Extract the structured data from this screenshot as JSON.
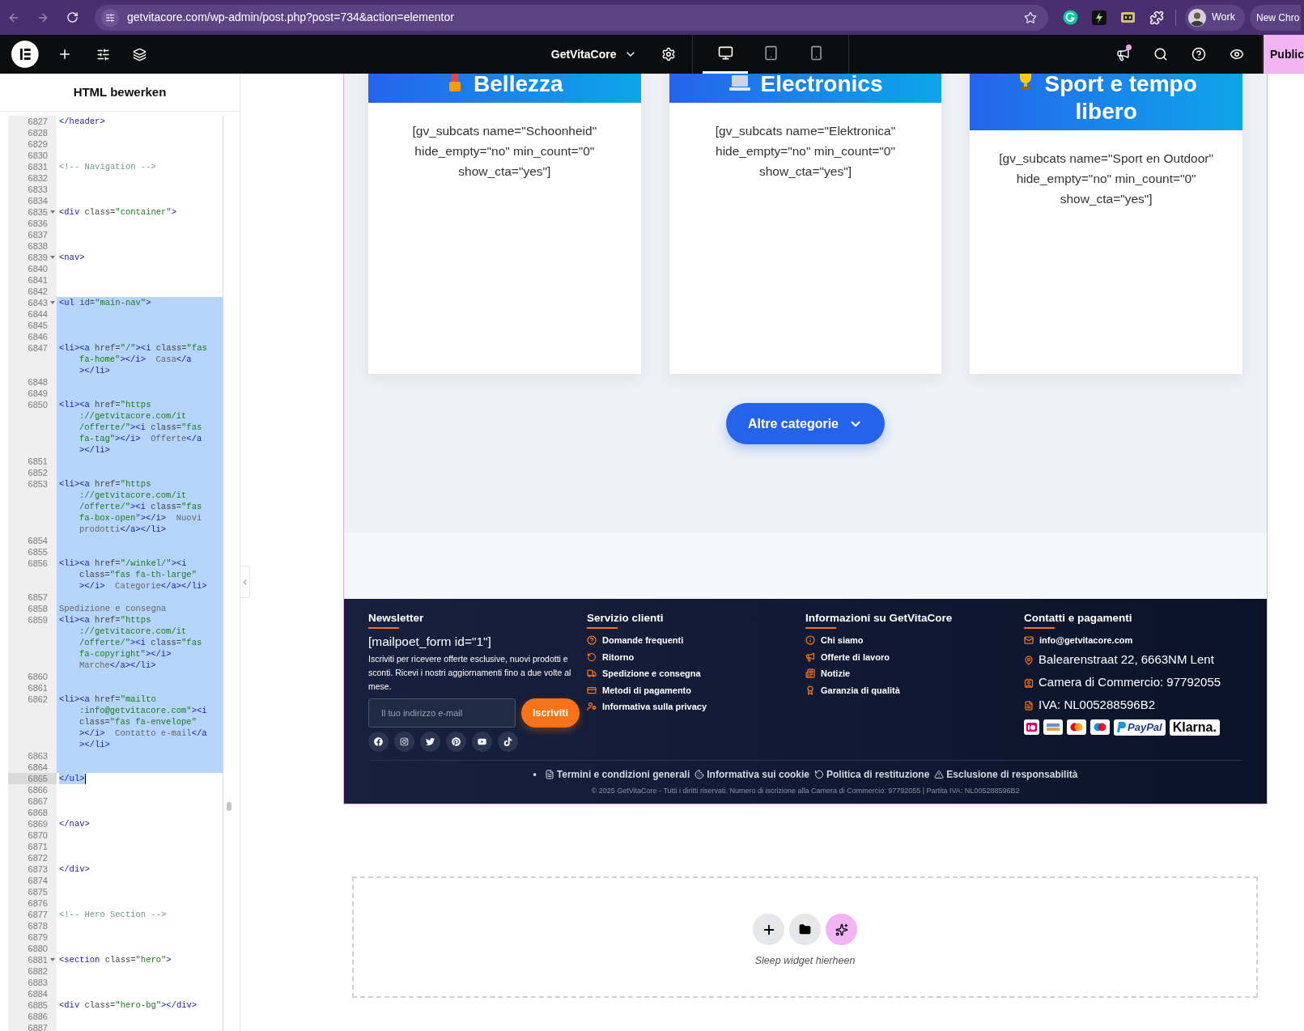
{
  "browser": {
    "url": "getvitacore.com/wp-admin/post.php?post=734&action=elementor",
    "profile": "Work",
    "new_window": "New Chro"
  },
  "editor_bar": {
    "site_name": "GetVitaCore",
    "devices": [
      {
        "kind": "desktop",
        "selected": true
      },
      {
        "kind": "tablet",
        "selected": false
      },
      {
        "kind": "mobile",
        "selected": false
      }
    ],
    "has_notification": true,
    "publish": "Public"
  },
  "html_panel": {
    "title": "HTML bewerken",
    "lines": [
      {
        "number": "6827",
        "selected": false,
        "active": false,
        "foldable": false,
        "rows": [
          {
            "tokens": [
              {
                "kind": "tag",
                "text": "</header>"
              }
            ]
          }
        ]
      },
      {
        "number": "6828",
        "selected": false,
        "active": false,
        "foldable": false
      },
      {
        "number": "6829",
        "selected": false,
        "active": false,
        "foldable": false
      },
      {
        "number": "6830",
        "selected": false,
        "active": false,
        "foldable": false
      },
      {
        "number": "6831",
        "selected": false,
        "active": false,
        "foldable": false,
        "rows": [
          {
            "tokens": [
              {
                "kind": "comment",
                "text": "<!-- Navigation -->"
              }
            ]
          }
        ]
      },
      {
        "number": "6832",
        "selected": false,
        "active": false,
        "foldable": false
      },
      {
        "number": "6833",
        "selected": false,
        "active": false,
        "foldable": false
      },
      {
        "number": "6834",
        "selected": false,
        "active": false,
        "foldable": false
      },
      {
        "number": "6835",
        "selected": false,
        "active": false,
        "foldable": true,
        "rows": [
          {
            "tokens": [
              {
                "kind": "tag",
                "text": "<div"
              },
              {
                "kind": "attr",
                "text": " class="
              },
              {
                "kind": "str",
                "text": "\"container\""
              },
              {
                "kind": "tag",
                "text": ">"
              }
            ]
          }
        ]
      },
      {
        "number": "6836",
        "selected": false,
        "active": false,
        "foldable": false
      },
      {
        "number": "6837",
        "selected": false,
        "active": false,
        "foldable": false
      },
      {
        "number": "6838",
        "selected": false,
        "active": false,
        "foldable": false
      },
      {
        "number": "6839",
        "selected": false,
        "active": false,
        "foldable": true,
        "rows": [
          {
            "tokens": [
              {
                "kind": "tag",
                "text": "<nav>"
              }
            ]
          }
        ]
      },
      {
        "number": "6840",
        "selected": false,
        "active": false,
        "foldable": false
      },
      {
        "number": "6841",
        "selected": false,
        "active": false,
        "foldable": false
      },
      {
        "number": "6842",
        "selected": false,
        "active": false,
        "foldable": false
      },
      {
        "number": "6843",
        "selected": true,
        "active": false,
        "foldable": true,
        "rows": [
          {
            "tokens": [
              {
                "kind": "tag",
                "text": "<ul"
              },
              {
                "kind": "attr",
                "text": " id="
              },
              {
                "kind": "str",
                "text": "\"main-nav\""
              },
              {
                "kind": "tag",
                "text": ">"
              }
            ]
          }
        ]
      },
      {
        "number": "6844",
        "selected": true,
        "active": false,
        "foldable": false
      },
      {
        "number": "6845",
        "selected": true,
        "active": false,
        "foldable": false
      },
      {
        "number": "6846",
        "selected": true,
        "active": false,
        "foldable": false
      },
      {
        "number": "6847",
        "selected": true,
        "active": false,
        "foldable": false,
        "rows": [
          {
            "tokens": [
              {
                "kind": "tag",
                "text": "<li><a"
              },
              {
                "kind": "attr",
                "text": " href="
              },
              {
                "kind": "str",
                "text": "\"/\""
              },
              {
                "kind": "tag",
                "text": "><i"
              },
              {
                "kind": "attr",
                "text": " class="
              },
              {
                "kind": "str",
                "text": "\"fas"
              }
            ]
          },
          {
            "tokens": [
              {
                "kind": "str",
                "text": "fa-home\""
              },
              {
                "kind": "tag",
                "text": "></i>"
              },
              {
                "kind": "text",
                "text": "  Casa"
              },
              {
                "kind": "tag",
                "text": "</a"
              }
            ]
          },
          {
            "tokens": [
              {
                "kind": "tag",
                "text": "></li>"
              }
            ]
          }
        ]
      },
      {
        "number": "6848",
        "selected": true,
        "active": false,
        "foldable": false
      },
      {
        "number": "6849",
        "selected": true,
        "active": false,
        "foldable": false
      },
      {
        "number": "6850",
        "selected": true,
        "active": false,
        "foldable": false,
        "rows": [
          {
            "tokens": [
              {
                "kind": "tag",
                "text": "<li><a"
              },
              {
                "kind": "attr",
                "text": " href="
              },
              {
                "kind": "str",
                "text": "\"https"
              }
            ]
          },
          {
            "tokens": [
              {
                "kind": "str",
                "text": "://getvitacore.com/it"
              }
            ]
          },
          {
            "tokens": [
              {
                "kind": "str",
                "text": "/offerte/\""
              },
              {
                "kind": "tag",
                "text": "><i"
              },
              {
                "kind": "attr",
                "text": " class="
              },
              {
                "kind": "str",
                "text": "\"fas"
              }
            ]
          },
          {
            "tokens": [
              {
                "kind": "str",
                "text": "fa-tag\""
              },
              {
                "kind": "tag",
                "text": "></i>"
              },
              {
                "kind": "text",
                "text": "  Offerte"
              },
              {
                "kind": "tag",
                "text": "</a"
              }
            ]
          },
          {
            "tokens": [
              {
                "kind": "tag",
                "text": "></li>"
              }
            ]
          }
        ]
      },
      {
        "number": "6851",
        "selected": true,
        "active": false,
        "foldable": false
      },
      {
        "number": "6852",
        "selected": true,
        "active": false,
        "foldable": false
      },
      {
        "number": "6853",
        "selected": true,
        "active": false,
        "foldable": false,
        "rows": [
          {
            "tokens": [
              {
                "kind": "tag",
                "text": "<li><a"
              },
              {
                "kind": "attr",
                "text": " href="
              },
              {
                "kind": "str",
                "text": "\"https"
              }
            ]
          },
          {
            "tokens": [
              {
                "kind": "str",
                "text": "://getvitacore.com/it"
              }
            ]
          },
          {
            "tokens": [
              {
                "kind": "str",
                "text": "/offerte/\""
              },
              {
                "kind": "tag",
                "text": "><i"
              },
              {
                "kind": "attr",
                "text": " class="
              },
              {
                "kind": "str",
                "text": "\"fas"
              }
            ]
          },
          {
            "tokens": [
              {
                "kind": "str",
                "text": "fa-box-open\""
              },
              {
                "kind": "tag",
                "text": "></i>"
              },
              {
                "kind": "text",
                "text": "  Nuovi"
              }
            ]
          },
          {
            "tokens": [
              {
                "kind": "text",
                "text": "prodotti"
              },
              {
                "kind": "tag",
                "text": "</a></li>"
              }
            ]
          }
        ]
      },
      {
        "number": "6854",
        "selected": true,
        "active": false,
        "foldable": false
      },
      {
        "number": "6855",
        "selected": true,
        "active": false,
        "foldable": false
      },
      {
        "number": "6856",
        "selected": true,
        "active": false,
        "foldable": false,
        "rows": [
          {
            "tokens": [
              {
                "kind": "tag",
                "text": "<li><a"
              },
              {
                "kind": "attr",
                "text": " href="
              },
              {
                "kind": "str",
                "text": "\"/winkel/\""
              },
              {
                "kind": "tag",
                "text": "><i"
              }
            ]
          },
          {
            "tokens": [
              {
                "kind": "attr",
                "text": "class="
              },
              {
                "kind": "str",
                "text": "\"fas fa-th-large\""
              }
            ]
          },
          {
            "tokens": [
              {
                "kind": "tag",
                "text": "></i>"
              },
              {
                "kind": "text",
                "text": "  Categorie"
              },
              {
                "kind": "tag",
                "text": "</a></li>"
              }
            ]
          }
        ]
      },
      {
        "number": "6857",
        "selected": true,
        "active": false,
        "foldable": false
      },
      {
        "number": "6858",
        "selected": true,
        "active": false,
        "foldable": false,
        "rows": [
          {
            "tokens": [
              {
                "kind": "text",
                "text": "Spedizione e consegna"
              }
            ]
          }
        ]
      },
      {
        "number": "6859",
        "selected": true,
        "active": false,
        "foldable": false,
        "rows": [
          {
            "tokens": [
              {
                "kind": "tag",
                "text": "<li><a"
              },
              {
                "kind": "attr",
                "text": " href="
              },
              {
                "kind": "str",
                "text": "\"https"
              }
            ]
          },
          {
            "tokens": [
              {
                "kind": "str",
                "text": "://getvitacore.com/it"
              }
            ]
          },
          {
            "tokens": [
              {
                "kind": "str",
                "text": "/offerte/\""
              },
              {
                "kind": "tag",
                "text": "><i"
              },
              {
                "kind": "attr",
                "text": " class="
              },
              {
                "kind": "str",
                "text": "\"fas"
              }
            ]
          },
          {
            "tokens": [
              {
                "kind": "str",
                "text": "fa-copyright\""
              },
              {
                "kind": "tag",
                "text": "></i>"
              }
            ]
          },
          {
            "tokens": [
              {
                "kind": "text",
                "text": "Marche"
              },
              {
                "kind": "tag",
                "text": "</a></li>"
              }
            ]
          }
        ]
      },
      {
        "number": "6860",
        "selected": true,
        "active": false,
        "foldable": false
      },
      {
        "number": "6861",
        "selected": true,
        "active": false,
        "foldable": false
      },
      {
        "number": "6862",
        "selected": true,
        "active": false,
        "foldable": false,
        "rows": [
          {
            "tokens": [
              {
                "kind": "tag",
                "text": "<li><a"
              },
              {
                "kind": "attr",
                "text": " href="
              },
              {
                "kind": "str",
                "text": "\"mailto"
              }
            ]
          },
          {
            "tokens": [
              {
                "kind": "str",
                "text": ":info@getvitacore.com\""
              },
              {
                "kind": "tag",
                "text": "><i"
              }
            ]
          },
          {
            "tokens": [
              {
                "kind": "attr",
                "text": "class="
              },
              {
                "kind": "str",
                "text": "\"fas fa-envelope\""
              }
            ]
          },
          {
            "tokens": [
              {
                "kind": "tag",
                "text": "></i>"
              },
              {
                "kind": "text",
                "text": "  Contatto e-mail"
              },
              {
                "kind": "tag",
                "text": "</a"
              }
            ]
          },
          {
            "tokens": [
              {
                "kind": "tag",
                "text": "></li>"
              }
            ]
          }
        ]
      },
      {
        "number": "6863",
        "selected": true,
        "active": false,
        "foldable": false
      },
      {
        "number": "6864",
        "selected": true,
        "active": false,
        "foldable": false
      },
      {
        "number": "6865",
        "selected": false,
        "active": true,
        "foldable": false,
        "rows": [
          {
            "tokens": [
              {
                "kind": "tag",
                "text": "</ul>"
              }
            ]
          }
        ]
      },
      {
        "number": "6866",
        "selected": false,
        "active": false,
        "foldable": false
      },
      {
        "number": "6867",
        "selected": false,
        "active": false,
        "foldable": false
      },
      {
        "number": "6868",
        "selected": false,
        "active": false,
        "foldable": false
      },
      {
        "number": "6869",
        "selected": false,
        "active": false,
        "foldable": false,
        "rows": [
          {
            "tokens": [
              {
                "kind": "tag",
                "text": "</nav>"
              }
            ]
          }
        ]
      },
      {
        "number": "6870",
        "selected": false,
        "active": false,
        "foldable": false
      },
      {
        "number": "6871",
        "selected": false,
        "active": false,
        "foldable": false
      },
      {
        "number": "6872",
        "selected": false,
        "active": false,
        "foldable": false
      },
      {
        "number": "6873",
        "selected": false,
        "active": false,
        "foldable": false,
        "rows": [
          {
            "tokens": [
              {
                "kind": "tag",
                "text": "</div>"
              }
            ]
          }
        ]
      },
      {
        "number": "6874",
        "selected": false,
        "active": false,
        "foldable": false
      },
      {
        "number": "6875",
        "selected": false,
        "active": false,
        "foldable": false
      },
      {
        "number": "6876",
        "selected": false,
        "active": false,
        "foldable": false
      },
      {
        "number": "6877",
        "selected": false,
        "active": false,
        "foldable": false,
        "rows": [
          {
            "tokens": [
              {
                "kind": "comment",
                "text": "<!-- Hero Section -->"
              }
            ]
          }
        ]
      },
      {
        "number": "6878",
        "selected": false,
        "active": false,
        "foldable": false
      },
      {
        "number": "6879",
        "selected": false,
        "active": false,
        "foldable": false
      },
      {
        "number": "6880",
        "selected": false,
        "active": false,
        "foldable": false
      },
      {
        "number": "6881",
        "selected": false,
        "active": false,
        "foldable": true,
        "rows": [
          {
            "tokens": [
              {
                "kind": "tag",
                "text": "<section"
              },
              {
                "kind": "attr",
                "text": " class="
              },
              {
                "kind": "str",
                "text": "\"hero\""
              },
              {
                "kind": "tag",
                "text": ">"
              }
            ]
          }
        ]
      },
      {
        "number": "6882",
        "selected": false,
        "active": false,
        "foldable": false
      },
      {
        "number": "6883",
        "selected": false,
        "active": false,
        "foldable": false
      },
      {
        "number": "6884",
        "selected": false,
        "active": false,
        "foldable": false
      },
      {
        "number": "6885",
        "selected": false,
        "active": false,
        "foldable": false,
        "rows": [
          {
            "tokens": [
              {
                "kind": "tag",
                "text": "<div"
              },
              {
                "kind": "attr",
                "text": " class="
              },
              {
                "kind": "str",
                "text": "\"hero-bg\""
              },
              {
                "kind": "tag",
                "text": "></div>"
              }
            ]
          }
        ]
      },
      {
        "number": "6886",
        "selected": false,
        "active": false,
        "foldable": false
      },
      {
        "number": "6887",
        "selected": false,
        "active": false,
        "foldable": false
      }
    ]
  },
  "canvas": {
    "cards": [
      {
        "title": "Bellezza",
        "body": "[gv_subcats name=\"Schoonheid\" hide_empty=\"no\" min_count=\"0\" show_cta=\"yes\"]"
      },
      {
        "title": "Electronics",
        "body": "[gv_subcats name=\"Elektronica\" hide_empty=\"no\" min_count=\"0\" show_cta=\"yes\"]"
      },
      {
        "title": "Sport e tempo libero",
        "body": "[gv_subcats name=\"Sport en Outdoor\" hide_empty=\"no\" min_count=\"0\" show_cta=\"yes\"]"
      }
    ],
    "more_button": "Altre categorie",
    "footer": {
      "newsletter": {
        "title": "Newsletter",
        "form_shortcode": "[mailpoet_form id=\"1\"]",
        "text": "Iscriviti per ricevere offerte esclusive, nuovi prodotti e sconti. Ricevi i nostri aggiornamenti fino a due volte al mese.",
        "email_placeholder": "Il tuo indirizzo e-mail",
        "subscribe": "Iscriviti"
      },
      "customer_service": {
        "title": "Servizio clienti",
        "links": [
          "Domande frequenti",
          "Ritorno",
          "Spedizione e consegna",
          "Metodi di pagamento",
          "Informativa sulla privacy"
        ]
      },
      "about": {
        "title": "Informazioni su GetVitaCore",
        "links": [
          "Chi siamo",
          "Offerte di lavoro",
          "Notizie",
          "Garanzia di qualità"
        ]
      },
      "contact": {
        "title": "Contatti e pagamenti",
        "email": "info@getvitacore.com",
        "details": [
          "Balearenstraat 22, 6663NM Lent",
          "Camera di Commercio: 97792055",
          "IVA: NL005288596B2"
        ],
        "payment_logos": [
          {
            "kind": "ideal"
          },
          {
            "kind": "bank"
          },
          {
            "kind": "mastercard"
          },
          {
            "kind": "maestro"
          },
          {
            "kind": "paypal",
            "text": "PayPal"
          },
          {
            "kind": "klarna",
            "text": "Klarna."
          }
        ]
      },
      "legal_bullet": "•",
      "legal_links": [
        "Termini e condizioni generali",
        "Informativa sui cookie",
        "Politica di restituzione",
        "Esclusione di responsabilità"
      ],
      "copyright": "© 2025 GetVitaCore - Tutti i diritti riservati. Numero di iscrizione alla Camera di Commercio: 97792055 | Partita IVA: NL005288596B2"
    },
    "drop_zone": {
      "label": "Sleep widget hierheen"
    }
  }
}
